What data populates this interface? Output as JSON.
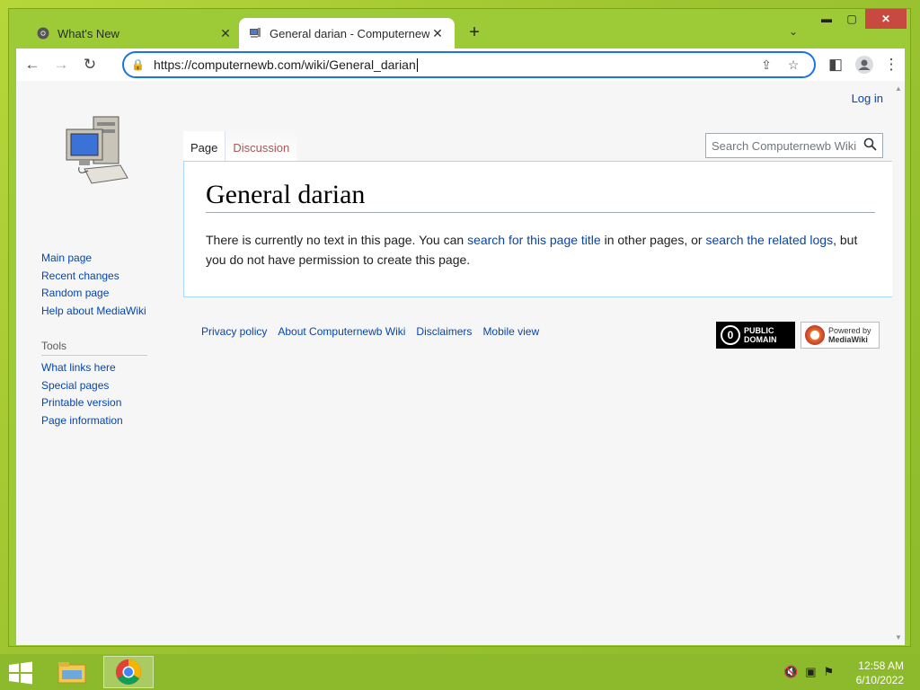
{
  "browser": {
    "tabs": [
      {
        "title": "What's New",
        "favicon": "chrome-icon"
      },
      {
        "title": "General darian - Computernewb",
        "favicon": "computer-icon"
      }
    ],
    "new_tab_label": "+",
    "url": "https://computernewb.com/wiki/General_darian"
  },
  "page": {
    "login_label": "Log in",
    "nav_items": [
      "Main page",
      "Recent changes",
      "Random page",
      "Help about MediaWiki"
    ],
    "tools_heading": "Tools",
    "tools_items": [
      "What links here",
      "Special pages",
      "Printable version",
      "Page information"
    ],
    "tab_page": "Page",
    "tab_discussion": "Discussion",
    "search_placeholder": "Search Computernewb Wiki",
    "title": "General darian",
    "body_text_1": "There is currently no text in this page. You can ",
    "body_link_1": "search for this page title",
    "body_text_2": " in other pages, or ",
    "body_link_2": "search the related logs",
    "body_text_3": ", but you do not have permission to create this page.",
    "footer_links": [
      "Privacy policy",
      "About Computernewb Wiki",
      "Disclaimers",
      "Mobile view"
    ],
    "badge_pd_line1": "PUBLIC",
    "badge_pd_line2": "DOMAIN",
    "badge_mw_line1": "Powered by",
    "badge_mw_line2": "MediaWiki"
  },
  "taskbar": {
    "time": "12:58 AM",
    "date": "6/10/2022"
  },
  "colors": {
    "link": "#0645ad",
    "accent": "#1a73e8",
    "desktop": "#9fc531"
  }
}
